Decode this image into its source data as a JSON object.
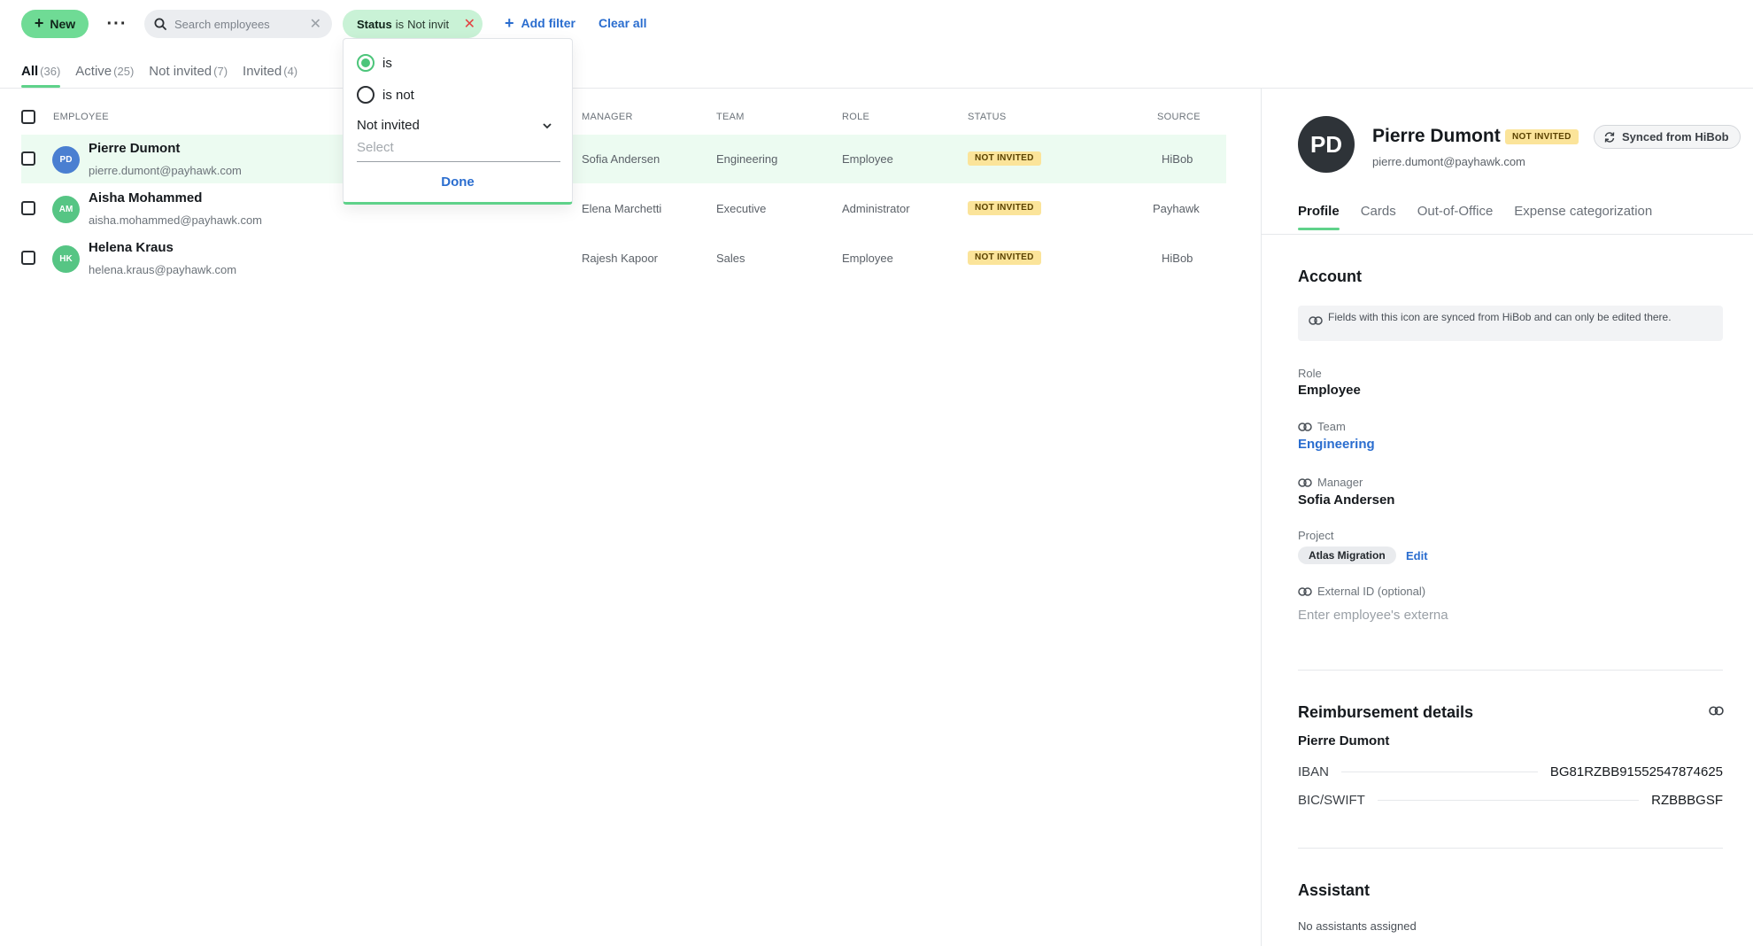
{
  "toolbar": {
    "new_label": "New",
    "more_label": "···",
    "search_placeholder": "Search employees",
    "filter_chip": {
      "key": "Status",
      "op": "is",
      "value": "Not invit"
    },
    "add_filter_label": "Add filter",
    "clear_all_label": "Clear all"
  },
  "tabs": [
    {
      "label": "All",
      "count": "(36)"
    },
    {
      "label": "Active",
      "count": "(25)"
    },
    {
      "label": "Not invited",
      "count": "(7)"
    },
    {
      "label": "Invited",
      "count": "(4)"
    }
  ],
  "table": {
    "headers": {
      "employee": "EMPLOYEE",
      "manager": "MANAGER",
      "team": "TEAM",
      "role": "ROLE",
      "status": "STATUS",
      "source": "SOURCE"
    },
    "rows": [
      {
        "initials": "PD",
        "avatar_color": "#4a7fd1",
        "name": "Pierre Dumont",
        "email": "pierre.dumont@payhawk.com",
        "manager": "Sofia Andersen",
        "team": "Engineering",
        "role": "Employee",
        "status": "NOT INVITED",
        "source": "HiBob"
      },
      {
        "initials": "AM",
        "avatar_color": "#56c584",
        "name": "Aisha Mohammed",
        "email": "aisha.mohammed@payhawk.com",
        "manager": "Elena Marchetti",
        "team": "Executive",
        "role": "Administrator",
        "status": "NOT INVITED",
        "source": "Payhawk"
      },
      {
        "initials": "HK",
        "avatar_color": "#56c584",
        "name": "Helena Kraus",
        "email": "helena.kraus@payhawk.com",
        "manager": "Rajesh Kapoor",
        "team": "Sales",
        "role": "Employee",
        "status": "NOT INVITED",
        "source": "HiBob"
      }
    ]
  },
  "dropdown": {
    "opt_is": "is",
    "opt_is_not": "is not",
    "selected_value": "Not invited",
    "select_placeholder": "Select",
    "done_label": "Done"
  },
  "profile": {
    "initials": "PD",
    "name": "Pierre Dumont",
    "badge": "NOT INVITED",
    "sync_label": "Synced from HiBob",
    "email": "pierre.dumont@payhawk.com",
    "tabs": [
      "Profile",
      "Cards",
      "Out-of-Office",
      "Expense categorization"
    ],
    "account_title": "Account",
    "info_text": "Fields with this icon are synced from HiBob and can only be edited there.",
    "role_label": "Role",
    "role_value": "Employee",
    "team_label": "Team",
    "team_value": "Engineering",
    "manager_label": "Manager",
    "manager_value": "Sofia Andersen",
    "project_label": "Project",
    "project_value": "Atlas Migration",
    "project_edit": "Edit",
    "external_label": "External ID (optional)",
    "external_placeholder": "Enter employee's externa",
    "reimb_title": "Reimbursement details",
    "reimb_name": "Pierre Dumont",
    "iban_label": "IBAN",
    "iban_value": "BG81RZBB91552547874625",
    "bic_label": "BIC/SWIFT",
    "bic_value": "RZBBBGSF",
    "assistant_title": "Assistant",
    "assistant_text": "No assistants assigned"
  },
  "colors": {
    "accent_green": "#5fd28a",
    "link_blue": "#2a6dcf",
    "badge_yellow": "#fbe49a"
  }
}
